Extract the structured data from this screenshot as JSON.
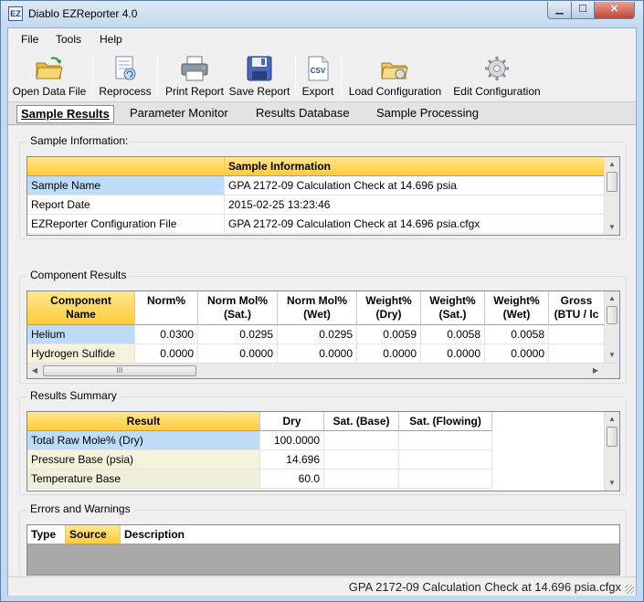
{
  "window": {
    "title": "Diablo EZReporter 4.0",
    "app_icon": "EZ",
    "min_icon": "▁",
    "max_icon": "☐",
    "close_icon": "✕"
  },
  "menu": [
    "File",
    "Tools",
    "Help"
  ],
  "toolbar": [
    {
      "label": "Open Data File",
      "icon": "open-folder-icon"
    },
    {
      "label": "Reprocess",
      "icon": "reprocess-icon"
    },
    {
      "label": "Print Report",
      "icon": "printer-icon"
    },
    {
      "label": "Save Report",
      "icon": "save-icon"
    },
    {
      "label": "Export",
      "icon": "csv-export-icon",
      "icon_text": "CSV"
    },
    {
      "label": "Load Configuration",
      "icon": "load-config-icon"
    },
    {
      "label": "Edit Configuration",
      "icon": "gear-icon"
    }
  ],
  "tabs": [
    "Sample Results",
    "Parameter Monitor",
    "Results Database",
    "Sample Processing"
  ],
  "sample_info": {
    "group_title": "Sample Information:",
    "header": "Sample Information",
    "rows": [
      {
        "label": "Sample Name",
        "value": "GPA 2172-09 Calculation Check at 14.696 psia"
      },
      {
        "label": "Report Date",
        "value": "2015-02-25 13:23:46"
      },
      {
        "label": "EZReporter Configuration File",
        "value": "GPA 2172-09 Calculation Check at 14.696 psia.cfgx"
      }
    ]
  },
  "component_results": {
    "group_title": "Component Results",
    "headers": [
      [
        "Component",
        "Name"
      ],
      [
        "Norm%",
        ""
      ],
      [
        "Norm Mol%",
        "(Sat.)"
      ],
      [
        "Norm Mol%",
        "(Wet)"
      ],
      [
        "Weight%",
        "(Dry)"
      ],
      [
        "Weight%",
        "(Sat.)"
      ],
      [
        "Weight%",
        "(Wet)"
      ],
      [
        "Gross",
        "(BTU / lc"
      ]
    ],
    "rows": [
      {
        "name": "Helium",
        "values": [
          "0.0300",
          "0.0295",
          "0.0295",
          "0.0059",
          "0.0058",
          "0.0058",
          ""
        ]
      },
      {
        "name": "Hydrogen Sulfide",
        "values": [
          "0.0000",
          "0.0000",
          "0.0000",
          "0.0000",
          "0.0000",
          "0.0000",
          ""
        ]
      }
    ],
    "hscroll_grip": "III"
  },
  "results_summary": {
    "group_title": "Results Summary",
    "headers": [
      "Result",
      "Dry",
      "Sat. (Base)",
      "Sat. (Flowing)"
    ],
    "rows": [
      {
        "result": "Total Raw Mole% (Dry)",
        "dry": "100.0000",
        "sat_base": "",
        "sat_flowing": ""
      },
      {
        "result": "Pressure Base (psia)",
        "dry": "14.696",
        "sat_base": "",
        "sat_flowing": ""
      },
      {
        "result": "Temperature Base",
        "dry": "60.0",
        "sat_base": "",
        "sat_flowing": ""
      }
    ]
  },
  "errors_warnings": {
    "group_title": "Errors and Warnings",
    "headers": [
      "Type",
      "Source",
      "Description"
    ]
  },
  "status": {
    "text": "GPA 2172-09 Calculation Check at 14.696 psia.cfgx"
  },
  "colors": {
    "accent_yellow": "#ffcb3c",
    "selected_row": "#bfdcf7",
    "cream_row": "#f6f3dc"
  }
}
